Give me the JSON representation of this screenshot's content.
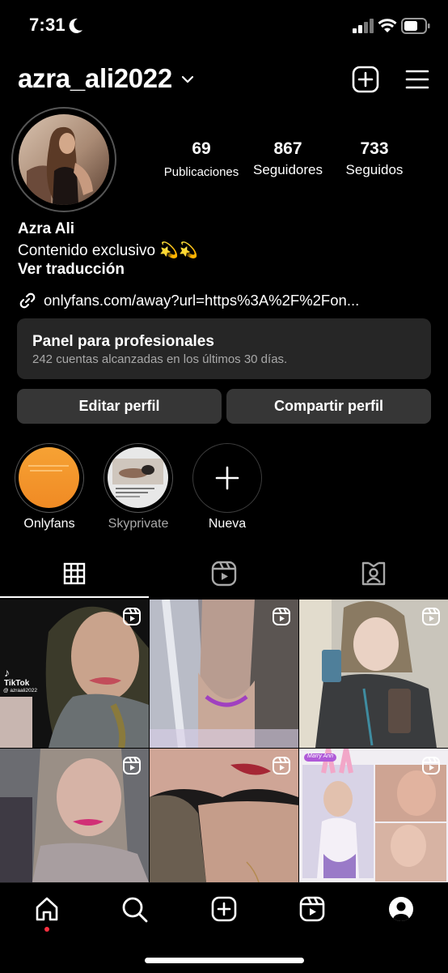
{
  "status_bar": {
    "time": "7:31"
  },
  "header": {
    "username": "azra_ali2022"
  },
  "stats": [
    {
      "value": "69",
      "label": "Publicaciones"
    },
    {
      "value": "867",
      "label": "Seguidores"
    },
    {
      "value": "733",
      "label": "Seguidos"
    }
  ],
  "bio": {
    "name": "Azra Ali",
    "text": "Contenido exclusivo 💫💫",
    "translate": "Ver traducción",
    "link": "onlyfans.com/away?url=https%3A%2F%2Fon..."
  },
  "panel": {
    "title": "Panel para profesionales",
    "subtitle": "242 cuentas alcanzadas en los últimos 30 días."
  },
  "buttons": {
    "edit": "Editar perfil",
    "share": "Compartir perfil"
  },
  "highlights": [
    {
      "label": "Onlyfans"
    },
    {
      "label": "Skyprivate"
    },
    {
      "label": "Nueva"
    }
  ],
  "tiles": {
    "tiktok_label": "TikTok",
    "tiktok_handle": "@ azraali2022",
    "sticker": "Marry Ann"
  },
  "colors": {
    "background": "#000000",
    "panel": "#262626",
    "button": "#363636",
    "notification_dot": "#ff3040"
  }
}
